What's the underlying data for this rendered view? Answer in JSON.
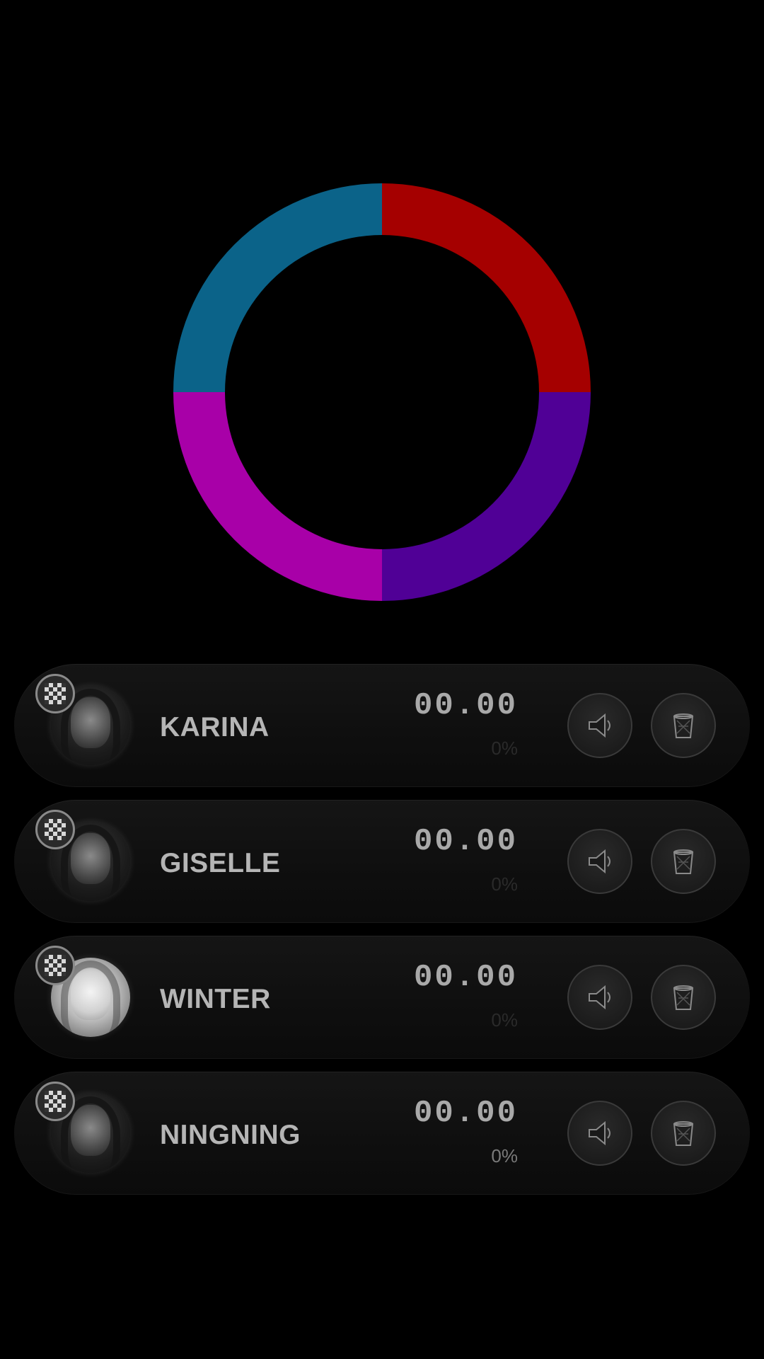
{
  "ring": {
    "segments": [
      {
        "name": "top-right",
        "color": "#A50000"
      },
      {
        "name": "bottom-right",
        "color": "#500096"
      },
      {
        "name": "bottom-left",
        "color": "#A800A8"
      },
      {
        "name": "top-left",
        "color": "#0B6389"
      }
    ]
  },
  "members": [
    {
      "name": "KARINA",
      "time": "00.00",
      "percent": "0%",
      "avatar": "karina-photo",
      "speaker_icon": "speaker-icon",
      "trash_icon": "trash-icon"
    },
    {
      "name": "GISELLE",
      "time": "00.00",
      "percent": "0%",
      "avatar": "giselle-photo",
      "speaker_icon": "speaker-icon",
      "trash_icon": "trash-icon"
    },
    {
      "name": "WINTER",
      "time": "00.00",
      "percent": "0%",
      "avatar": "winter-photo",
      "speaker_icon": "speaker-icon",
      "trash_icon": "trash-icon"
    },
    {
      "name": "NINGNING",
      "time": "00.00",
      "percent": "0%",
      "avatar": "ningning-photo",
      "speaker_icon": "speaker-icon",
      "trash_icon": "trash-icon"
    }
  ]
}
